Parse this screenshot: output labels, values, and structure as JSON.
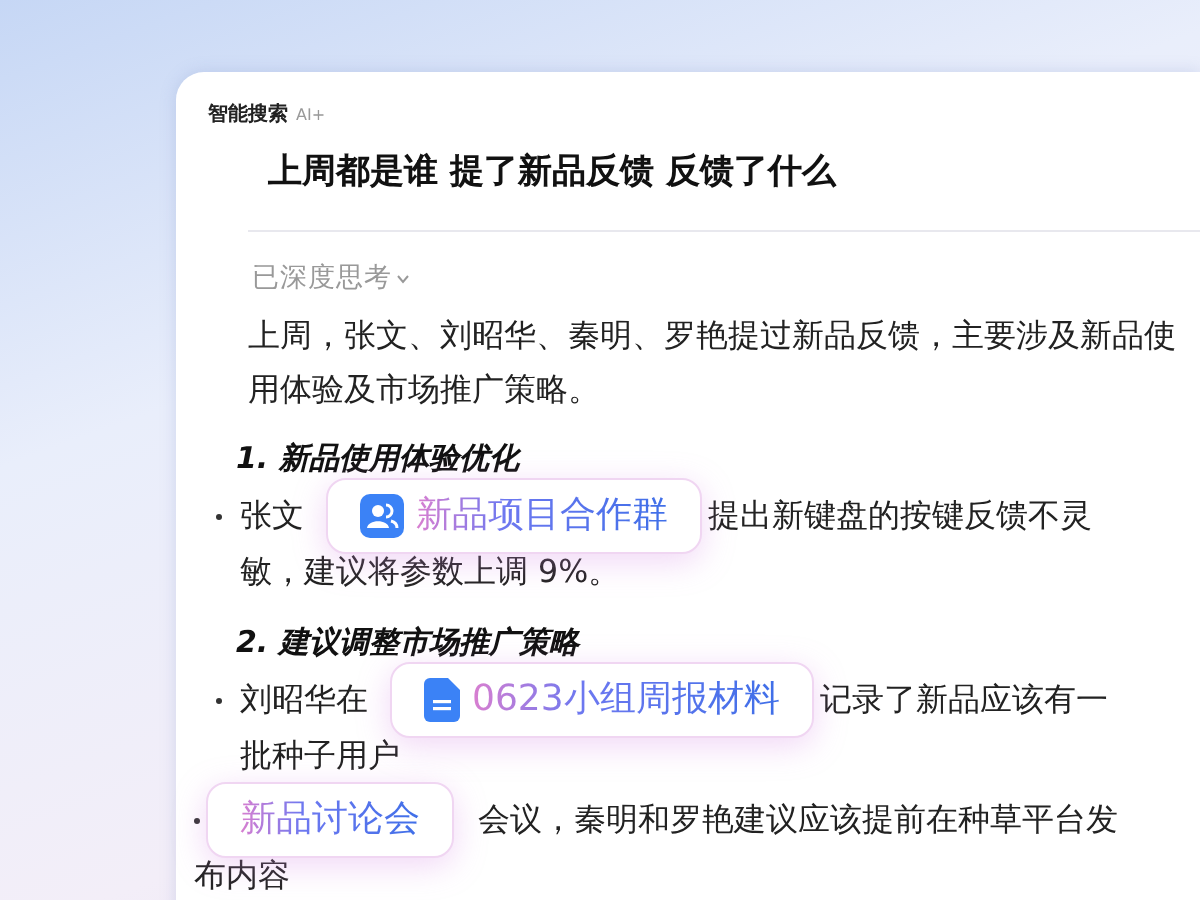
{
  "app": {
    "title": "智能搜索",
    "badge": "AI+"
  },
  "question": "上周都是谁 提了新品反馈 反馈了什么",
  "thinking": {
    "label": "已深度思考",
    "expanded": false
  },
  "summary": "上周，张文、刘昭华、秦明、罗艳提过新品反馈，主要涉及新品使用体验及市场推广策略。",
  "sections": [
    {
      "heading": "1. 新品使用体验优化",
      "bullets": [
        {
          "before": "张文",
          "source": {
            "kind": "group",
            "label": "新品项目合作群"
          },
          "after": "提出新键盘的按键反馈不灵",
          "continued": "敏，建议将参数上调 9%。"
        }
      ]
    },
    {
      "heading": "2. 建议调整市场推广策略",
      "bullets": [
        {
          "before": "刘昭华在",
          "source": {
            "kind": "doc",
            "label": "0623小组周报材料"
          },
          "after": "记录了新品应该有一",
          "continued": "批种子用户"
        },
        {
          "source": {
            "kind": "meeting",
            "label": "新品讨论会"
          },
          "after": "会议，秦明和罗艳建议应该提前在种草平台发",
          "continued": "布内容"
        }
      ]
    }
  ]
}
